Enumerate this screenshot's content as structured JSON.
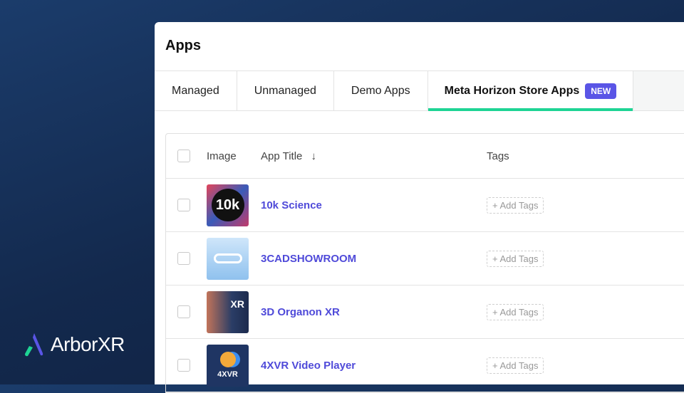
{
  "brand": {
    "name": "ArborXR"
  },
  "page": {
    "title": "Apps"
  },
  "tabs": [
    {
      "label": "Managed"
    },
    {
      "label": "Unmanaged"
    },
    {
      "label": "Demo Apps"
    },
    {
      "label": "Meta Horizon Store Apps",
      "badge": "NEW",
      "active": true
    }
  ],
  "table": {
    "columns": {
      "image": "Image",
      "title": "App Title",
      "tags": "Tags"
    },
    "rows": [
      {
        "title": "10k Science",
        "thumb_text": "10k",
        "add_tags": "+ Add Tags"
      },
      {
        "title": "3CADSHOWROOM",
        "thumb_text": "",
        "add_tags": "+ Add Tags"
      },
      {
        "title": "3D Organon XR",
        "thumb_text": "XR",
        "add_tags": "+ Add Tags"
      },
      {
        "title": "4XVR Video Player",
        "thumb_text": "4XVR",
        "add_tags": "+ Add Tags"
      }
    ]
  },
  "colors": {
    "accent": "#5a55e6",
    "tab_underline": "#1ed494",
    "link": "#4f4ad9"
  }
}
